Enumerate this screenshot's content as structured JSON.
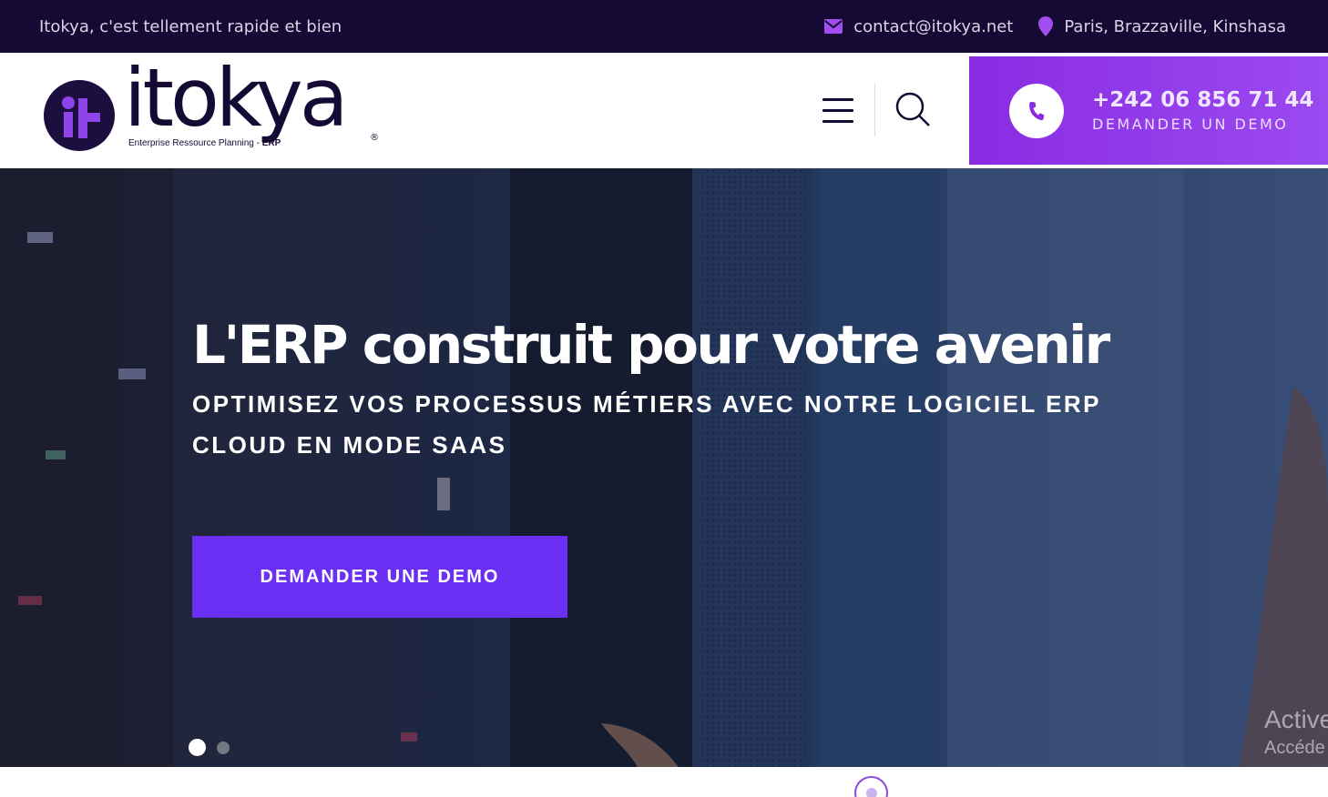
{
  "topbar": {
    "tagline": "Itokya, c'est tellement rapide et bien",
    "email": "contact@itokya.net",
    "location": "Paris, Brazzaville, Kinshasa",
    "email_icon": "envelope-icon",
    "location_icon": "map-pin-icon"
  },
  "header": {
    "logo_word": "itokya",
    "logo_subtitle_main": "Enterprise Ressource Planning -",
    "logo_subtitle_bold": "ERP",
    "logo_reg": "®",
    "menu_icon": "hamburger-menu-icon",
    "search_icon": "search-icon",
    "cta": {
      "phone": "+242 06 856 71 44",
      "label": "DEMANDER UN DEMO",
      "icon": "phone-icon"
    }
  },
  "hero": {
    "title": "L'ERP construit pour votre avenir",
    "subtitle": "OPTIMISEZ VOS PROCESSUS MÉTIERS AVEC NOTRE LOGICIEL ERP CLOUD EN MODE SAAS",
    "button_label": "DEMANDER UNE DEMO",
    "slides": [
      {
        "active": true
      },
      {
        "active": false
      }
    ]
  },
  "watermark": {
    "line1": "Active",
    "line2": "Accéde"
  },
  "colors": {
    "topbar_bg": "#150a33",
    "accent_purple": "#8a2be2",
    "hero_button": "#6a2ff2"
  }
}
